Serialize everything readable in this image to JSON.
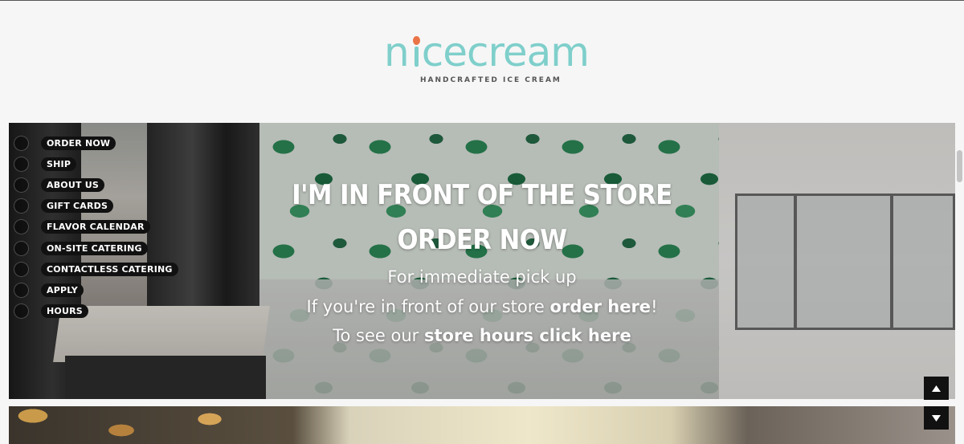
{
  "header": {
    "logo_pre": "n",
    "logo_post": "cecream",
    "tagline": "HANDCRAFTED ICE CREAM"
  },
  "nav": {
    "items": [
      {
        "label": "ORDER NOW"
      },
      {
        "label": "SHIP"
      },
      {
        "label": "ABOUT US"
      },
      {
        "label": "GIFT CARDS"
      },
      {
        "label": "FLAVOR CALENDAR"
      },
      {
        "label": "ON-SITE CATERING"
      },
      {
        "label": "CONTACTLESS CATERING"
      },
      {
        "label": "APPLY"
      },
      {
        "label": "HOURS"
      }
    ]
  },
  "hero": {
    "title_line1": "I'M IN FRONT OF THE STORE",
    "title_line2": "ORDER NOW",
    "line1": "For immediate pick up",
    "line2_pre": "If you're in front of our store ",
    "line2_link": "order here",
    "line2_post": "!",
    "line3_pre": "To see our ",
    "line3_link": "store hours click here"
  },
  "controls": {
    "scroll_up_icon": "triangle-up-icon",
    "scroll_down_icon": "triangle-down-icon"
  },
  "colors": {
    "logo_teal": "#7fcfcb",
    "logo_accent": "#ea7447",
    "nav_pill": "#111111"
  }
}
